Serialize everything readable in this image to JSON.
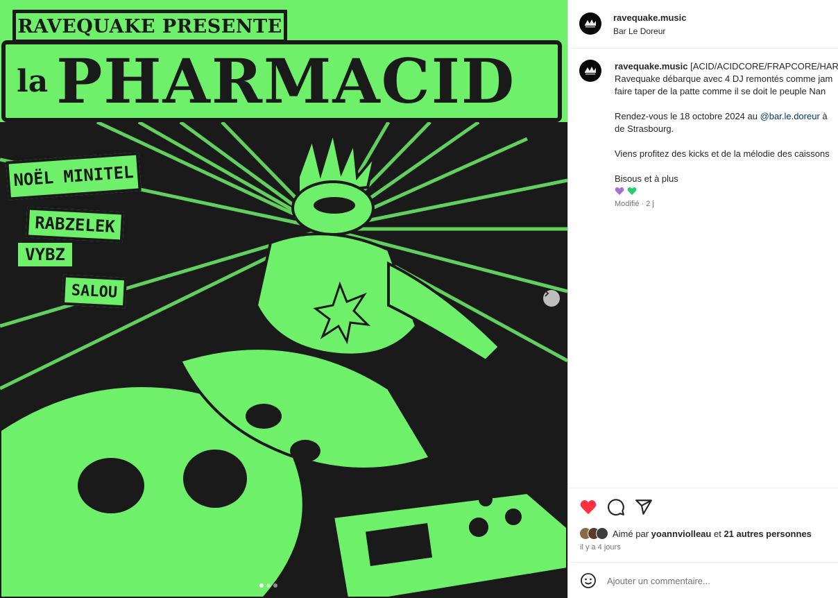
{
  "poster": {
    "header": "RAVEQUAKE PRESENTE",
    "title_prefix": "la",
    "title": "PHARMACID",
    "djs": [
      "NOËL MINITEL",
      "RABZELEK",
      "VYBZ",
      "SALOU"
    ],
    "background_color": "#6ef06a",
    "ink_color": "#1a1a1a",
    "carousel": {
      "next_icon": "chevron-right-icon",
      "slides": 3,
      "active_slide": 1
    }
  },
  "post": {
    "header": {
      "username": "ravequake.music",
      "location": "Bar Le Doreur"
    },
    "caption": {
      "username": "ravequake.music",
      "line1": "[ACID/ACIDCORE/FRAPCORE/HARD",
      "line2": "Ravequake débarque avec 4 DJ remontés comme jam",
      "line3": "faire taper de la patte comme il se doit le peuple Nan",
      "line4_before": "Rendez-vous le 18 octobre 2024 au ",
      "line4_mention": "@bar.le.doreur",
      "line4_after": " à",
      "line5": "de Strasbourg.",
      "line6": "Viens profitez des kicks et de la mélodie des caissons",
      "line7": "Bisous et à plus",
      "emojis": [
        "purple-heart",
        "green-heart"
      ],
      "modified": "Modifié · 2 j"
    },
    "actions": {
      "like_icon": "heart-filled-icon",
      "comment_icon": "comment-icon",
      "share_icon": "send-icon",
      "liked_color": "#ff3040"
    },
    "likes": {
      "prefix": "Aimé par ",
      "user": "yoannviolleau",
      "middle": " et ",
      "others": "21 autres personnes"
    },
    "timestamp": "il y a 4 jours",
    "comment": {
      "emoji_icon": "smiley-icon",
      "placeholder": "Ajouter un commentaire..."
    }
  }
}
